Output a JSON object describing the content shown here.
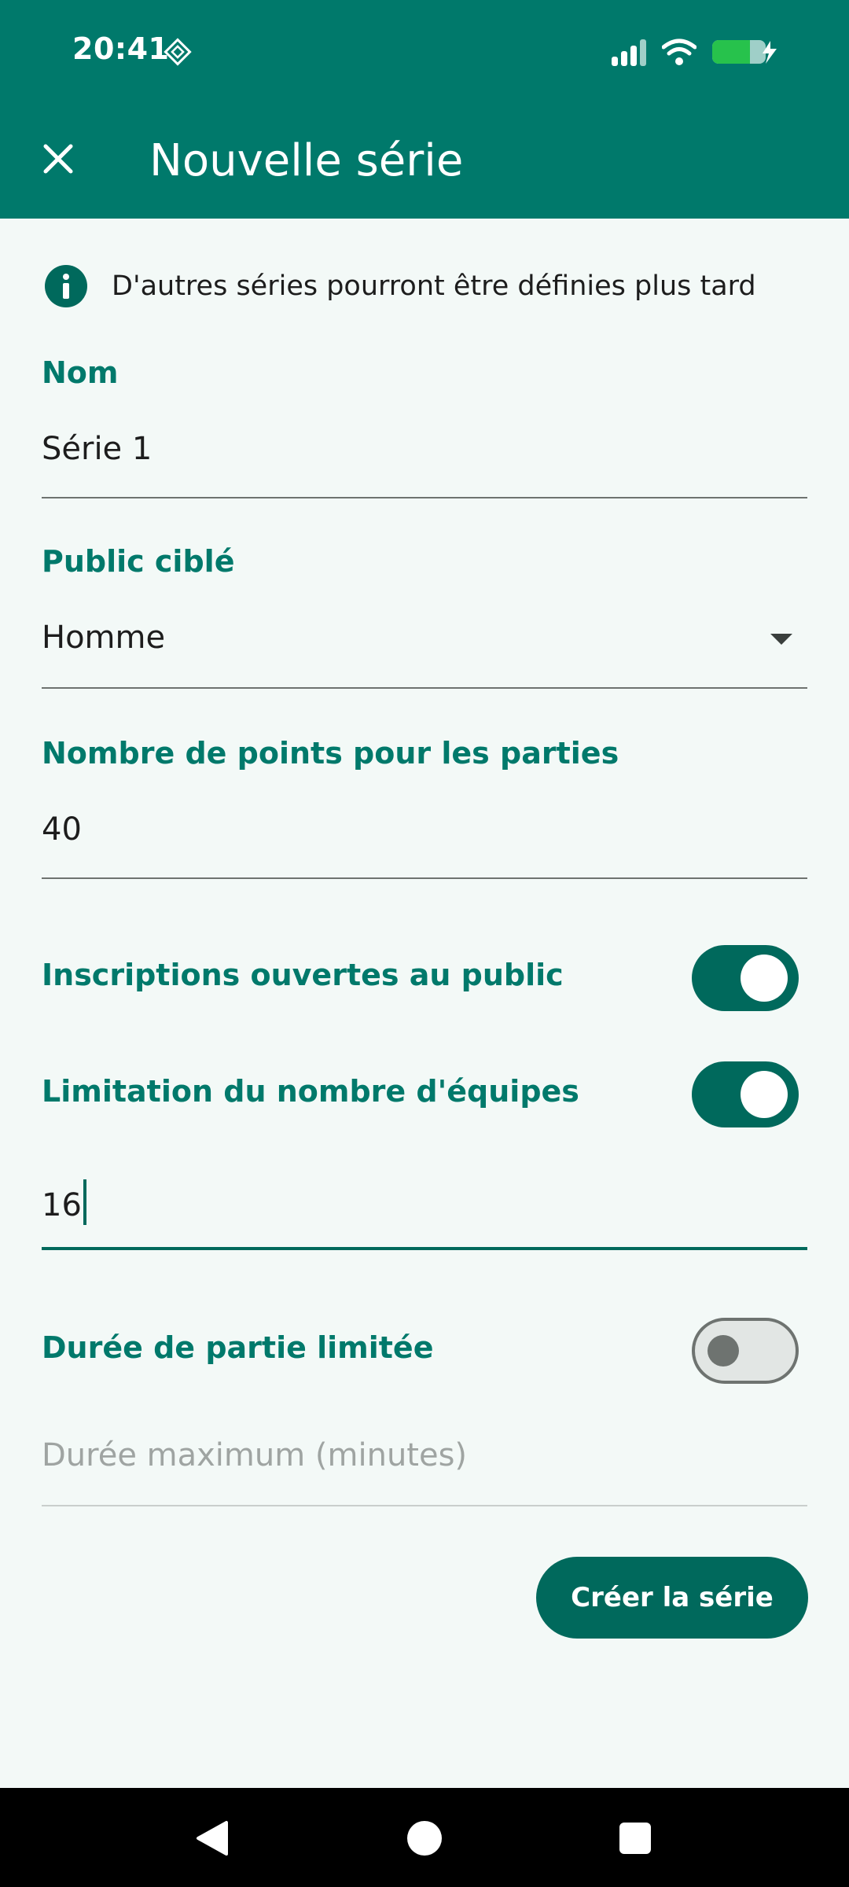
{
  "status_bar": {
    "time": "20:41",
    "icons": [
      "network-glyph-icon",
      "signal-icon",
      "wifi-icon",
      "battery-charging-icon"
    ]
  },
  "app_bar": {
    "title": "Nouvelle série",
    "close_icon": "close-icon"
  },
  "info": {
    "text": "D'autres séries pourront être définies plus tard",
    "icon": "info-icon"
  },
  "form": {
    "nom": {
      "label": "Nom",
      "value": "Série 1"
    },
    "public": {
      "label": "Public ciblé",
      "value": "Homme"
    },
    "points": {
      "label": "Nombre de points pour les parties",
      "value": "40"
    },
    "inscriptions": {
      "label": "Inscriptions ouvertes au public",
      "enabled": true
    },
    "limitation": {
      "label": "Limitation du nombre d'équipes",
      "enabled": true,
      "value": "16"
    },
    "duree": {
      "label": "Durée de partie limitée",
      "enabled": false,
      "placeholder": "Durée maximum (minutes)"
    }
  },
  "actions": {
    "create_label": "Créer la série"
  },
  "colors": {
    "primary": "#00796b",
    "primary_dark": "#00695c",
    "background": "#f3f9f7"
  }
}
